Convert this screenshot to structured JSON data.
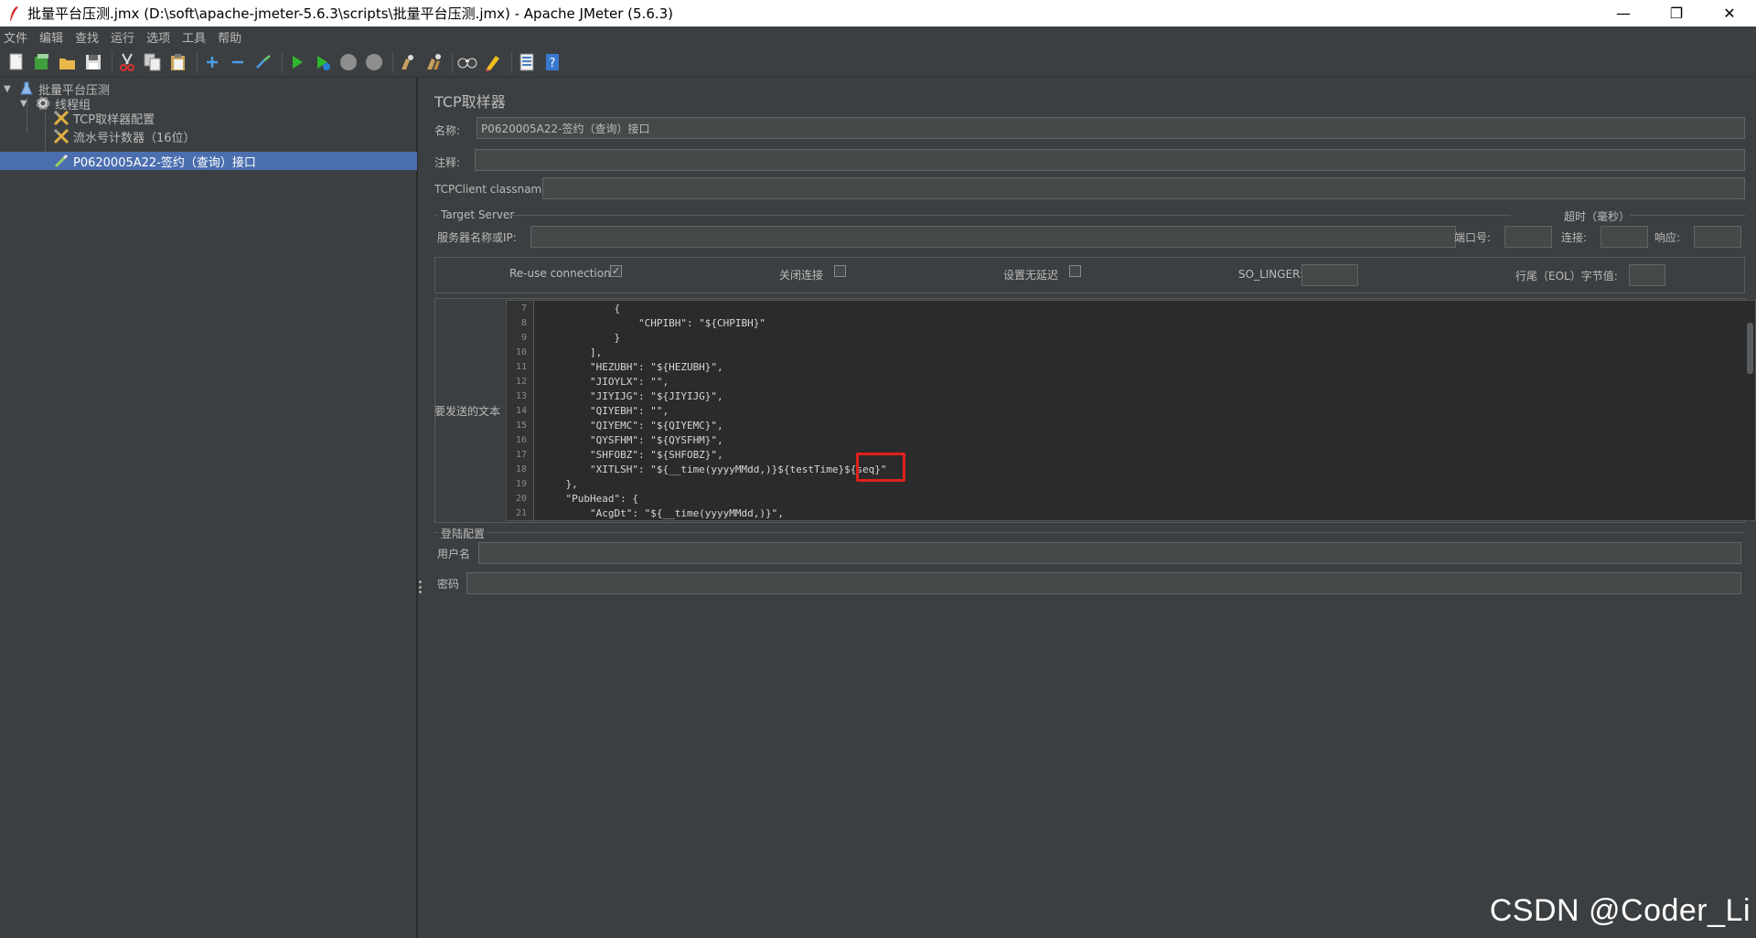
{
  "window": {
    "title": "批量平台压测.jmx (D:\\soft\\apache-jmeter-5.6.3\\scripts\\批量平台压测.jmx) - Apache JMeter (5.6.3)",
    "minimize": "—",
    "maximize": "❐",
    "close": "✕"
  },
  "menu": [
    "文件",
    "编辑",
    "查找",
    "运行",
    "选项",
    "工具",
    "帮助"
  ],
  "toolbar": {
    "icons": [
      "new-icon",
      "templates-icon",
      "open-icon",
      "save-icon",
      "cut-icon",
      "copy-icon",
      "paste-icon",
      "expand-icon",
      "collapse-icon",
      "toggle-icon",
      "start-icon",
      "start-no-pause-icon",
      "stop-icon",
      "shutdown-icon",
      "clear-icon",
      "clear-all-icon",
      "search-icon",
      "reset-search-icon",
      "function-helper-icon",
      "help-icon"
    ]
  },
  "tree": {
    "items": [
      {
        "label": "批量平台压测",
        "icon": "test-plan-icon"
      },
      {
        "label": "线程组",
        "icon": "thread-group-icon"
      },
      {
        "label": "TCP取样器配置",
        "icon": "config-element-icon"
      },
      {
        "label": "流水号计数器（16位）",
        "icon": "counter-icon"
      },
      {
        "label": "P0620005A22-签约（查询）接口",
        "icon": "sampler-icon"
      }
    ]
  },
  "panel": {
    "title": "TCP取样器",
    "name_label": "名称:",
    "name_value": "P0620005A22-签约（查询）接口",
    "comment_label": "注释:",
    "comment_value": "",
    "classname_label": "TCPClient classname:",
    "classname_value": "",
    "target_server_label": "Target Server",
    "timeout_label": "超时（毫秒）",
    "server_label": "服务器名称或IP:",
    "server_value": "",
    "port_label": "端口号:",
    "port_value": "",
    "connect_label": "连接:",
    "connect_value": "",
    "response_label": "响应:",
    "response_value": "",
    "reuse_label": "Re-use connection",
    "reuse_checked": true,
    "close_label": "关闭连接",
    "close_checked": false,
    "nodelay_label": "设置无延迟",
    "nodelay_checked": false,
    "solinger_label": "SO_LINGER:",
    "solinger_value": "",
    "eol_label": "行尾（EOL）字节值:",
    "eol_value": "",
    "text_label": "要发送的文本",
    "code": {
      "line_numbers": [
        "7",
        "8",
        "9",
        "10",
        "11",
        "12",
        "13",
        "14",
        "15",
        "16",
        "17",
        "18",
        "19",
        "20",
        "21"
      ],
      "lines": [
        "            {",
        "                \"CHPIBH\": \"${CHPIBH}\"",
        "            }",
        "        ],",
        "        \"HEZUBH\": \"${HEZUBH}\",",
        "        \"JIOYLX\": \"\",",
        "        \"JIYIJG\": \"${JIYIJG}\",",
        "        \"QIYEBH\": \"\",",
        "        \"QIYEMC\": \"${QIYEMC}\",",
        "        \"QYSFHM\": \"${QYSFHM}\",",
        "        \"SHFOBZ\": \"${SHFOBZ}\",",
        "        \"XITLSH\": \"${__time(yyyyMMdd,)}${testTime}${seq}\"",
        "    },",
        "    \"PubHead\": {",
        "        \"AcgDt\": \"${__time(yyyyMMdd,)}\","
      ]
    },
    "login_label": "登陆配置",
    "user_label": "用户名",
    "user_value": "",
    "password_label": "密码",
    "password_value": ""
  },
  "watermark": "CSDN @Coder_Li"
}
